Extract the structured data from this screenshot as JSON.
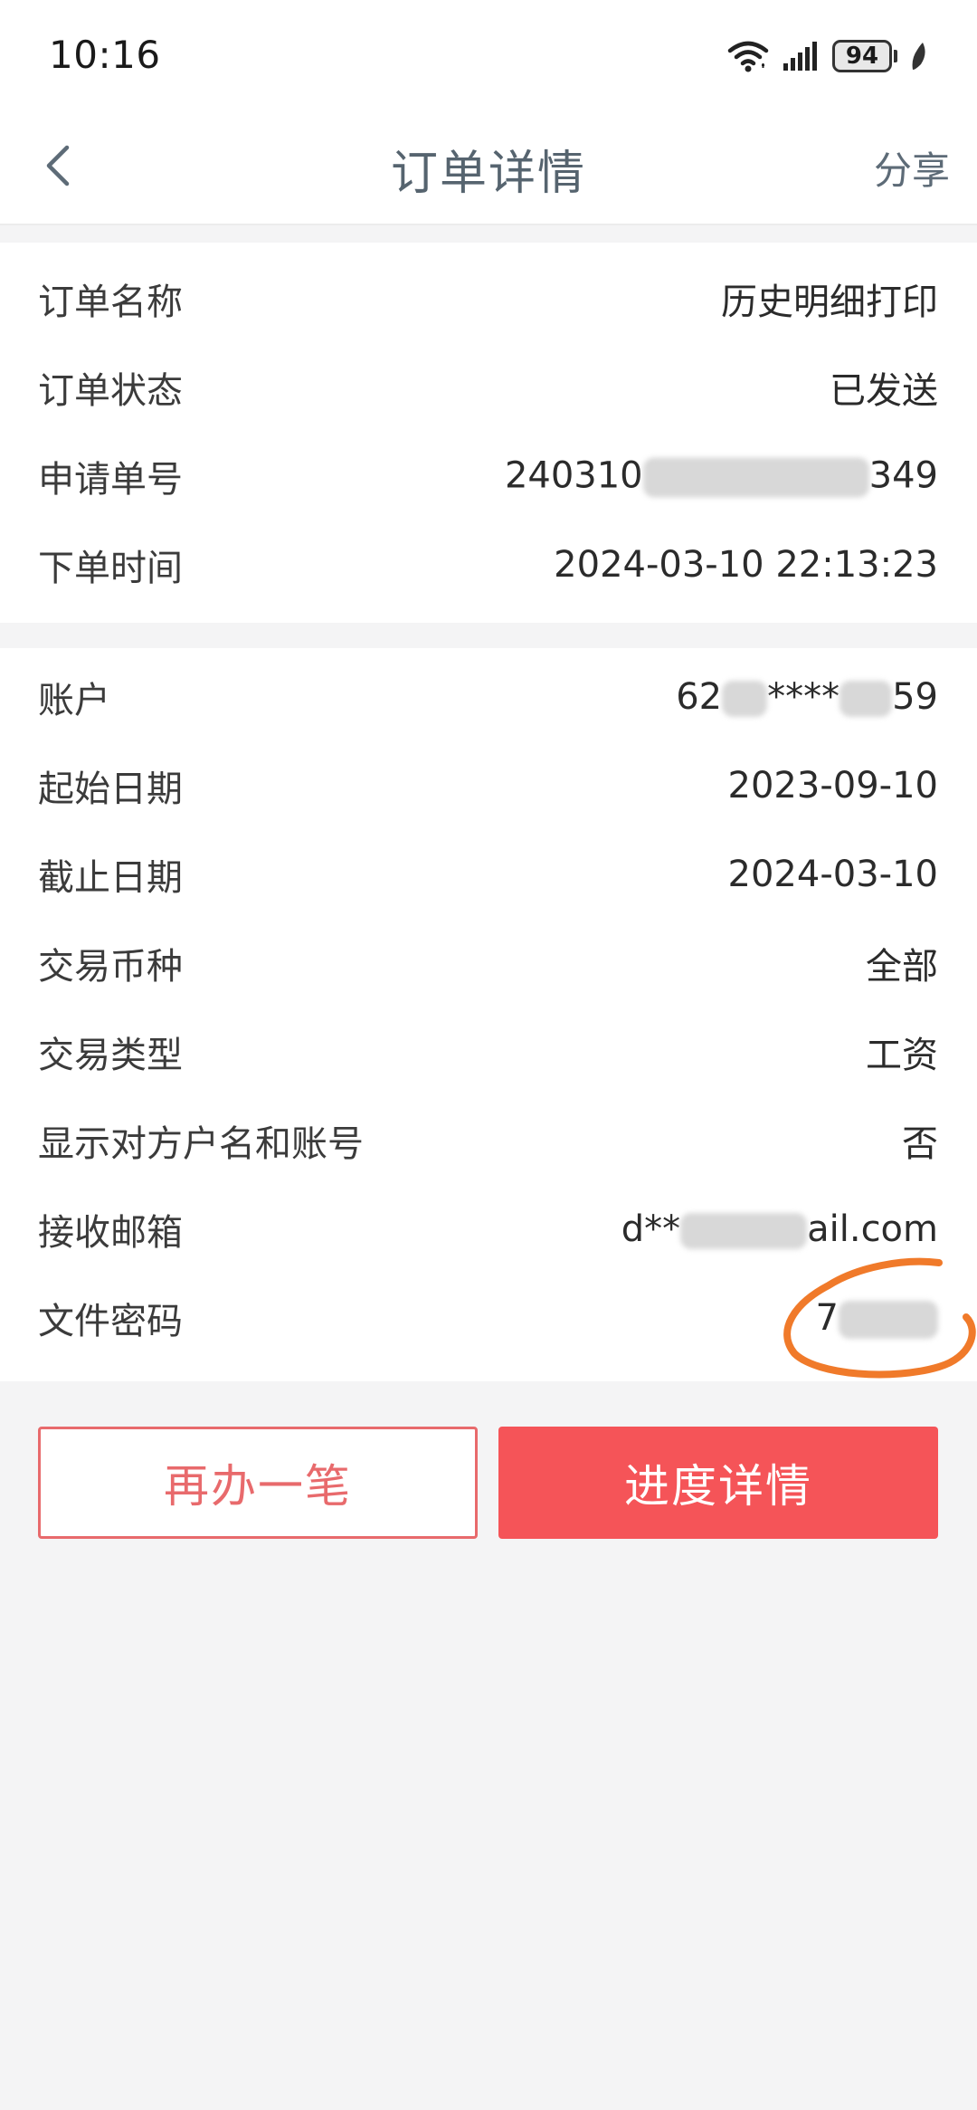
{
  "status_bar": {
    "time": "10:16",
    "battery": "94",
    "icons": [
      "wifi-icon",
      "signal-icon",
      "battery-icon",
      "leaf-icon"
    ]
  },
  "nav": {
    "back_icon": "chevron-left-icon",
    "title": "订单详情",
    "share_label": "分享"
  },
  "order_info": [
    {
      "label": "订单名称",
      "value": "历史明细打印"
    },
    {
      "label": "订单状态",
      "value": "已发送"
    },
    {
      "label": "申请单号",
      "value_prefix": "240310",
      "value_suffix": "349"
    },
    {
      "label": "下单时间",
      "value": "2024-03-10 22:13:23"
    }
  ],
  "details": [
    {
      "label": "账户",
      "value_prefix": "62",
      "value_middle": "****",
      "value_suffix": "59"
    },
    {
      "label": "起始日期",
      "value": "2023-09-10"
    },
    {
      "label": "截止日期",
      "value": "2024-03-10"
    },
    {
      "label": "交易币种",
      "value": "全部"
    },
    {
      "label": "交易类型",
      "value": "工资"
    },
    {
      "label": "显示对方户名和账号",
      "value": "否"
    },
    {
      "label": "接收邮箱",
      "value_prefix": "d**",
      "value_suffix": "ail.com"
    },
    {
      "label": "文件密码",
      "value_prefix": "7"
    }
  ],
  "actions": {
    "again_label": "再办一笔",
    "progress_label": "进度详情"
  },
  "colors": {
    "accent_red": "#f55458",
    "outline_red": "#e86a6c",
    "annotation_orange": "#f07a2a",
    "title_gray": "#56646f",
    "background": "#f4f4f5"
  }
}
